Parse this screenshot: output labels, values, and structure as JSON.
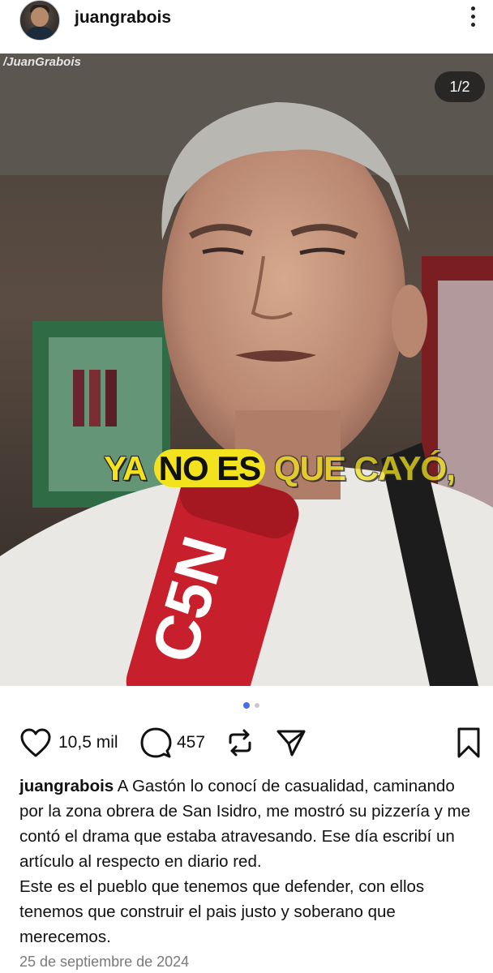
{
  "header": {
    "username": "juangrabois",
    "avatar_icon": "profile-photo",
    "more_icon": "more-vertical-icon"
  },
  "media": {
    "watermark": "/JuanGrabois",
    "counter": "1/2",
    "caption_words": [
      "YA ",
      "NO ES",
      " QUE CAYÓ,"
    ],
    "caption_color": "#f3e21e",
    "mic_brand": "C5N",
    "slides_total": 2,
    "slide_active": 1
  },
  "actions": {
    "likes": "10,5 mil",
    "comments": "457",
    "icons": [
      "heart-icon",
      "comment-icon",
      "repost-icon",
      "share-icon",
      "bookmark-icon"
    ]
  },
  "post": {
    "author": "juangrabois",
    "text": " A Gastón lo conocí de casualidad, caminando por la zona obrera de San Isidro, me mostró su pizzería y me contó el drama que estaba atravesando. Ese día escribí un artículo al respecto en diario red.",
    "text2": "Este es el pueblo que tenemos que defender, con ellos tenemos que construir el pais justo y soberano que merecemos.",
    "date": "25 de septiembre de 2024"
  },
  "colors": {
    "accent": "#4a6de5",
    "text": "#111111",
    "muted": "#7a7a7a"
  }
}
